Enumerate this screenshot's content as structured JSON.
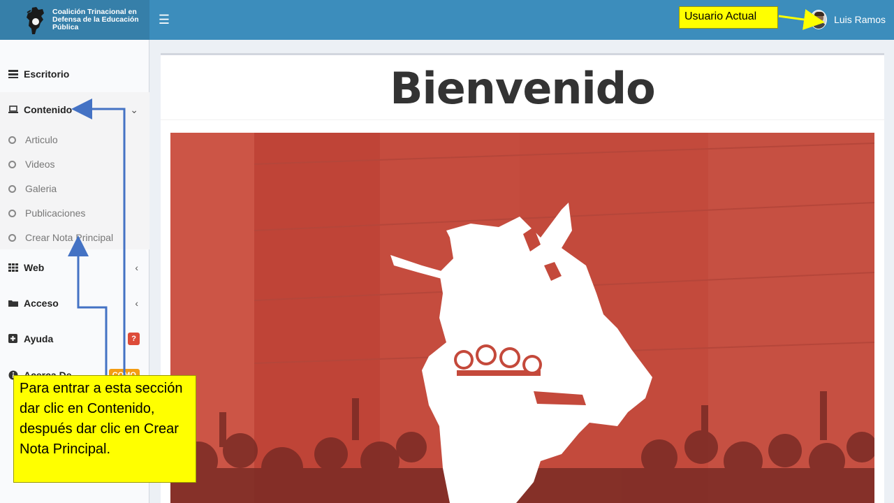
{
  "header": {
    "logo_text": "Coalición Trinacional en Defensa de la Educación Pública",
    "menu_icon": "hamburger-icon",
    "user_name": "Luis Ramos"
  },
  "sidebar": {
    "items": [
      {
        "label": "Escritorio",
        "icon": "dashboard-icon"
      },
      {
        "label": "Contenido",
        "icon": "laptop-icon"
      },
      {
        "label": "Web",
        "icon": "grid-icon"
      },
      {
        "label": "Acceso",
        "icon": "folder-icon"
      },
      {
        "label": "Ayuda",
        "icon": "plus-square-icon",
        "badge": "?"
      },
      {
        "label": "Acerca De...",
        "icon": "info-circle-icon",
        "badge": "COMO"
      }
    ],
    "submenu": [
      "Articulo",
      "Videos",
      "Galeria",
      "Publicaciones",
      "Crear Nota Principal"
    ]
  },
  "main": {
    "title": "Bienvenido"
  },
  "annotations": {
    "user_label": "Usuario Actual",
    "instructions": "Para entrar a esta sección dar clic en Contenido, después dar clic en Crear Nota Principal."
  },
  "colors": {
    "header": "#3c8dbc",
    "logo_bg": "#367fa9",
    "hero_red": "#c0392b",
    "annotation_yellow": "#ffff00",
    "arrow_blue": "#4472c4"
  }
}
